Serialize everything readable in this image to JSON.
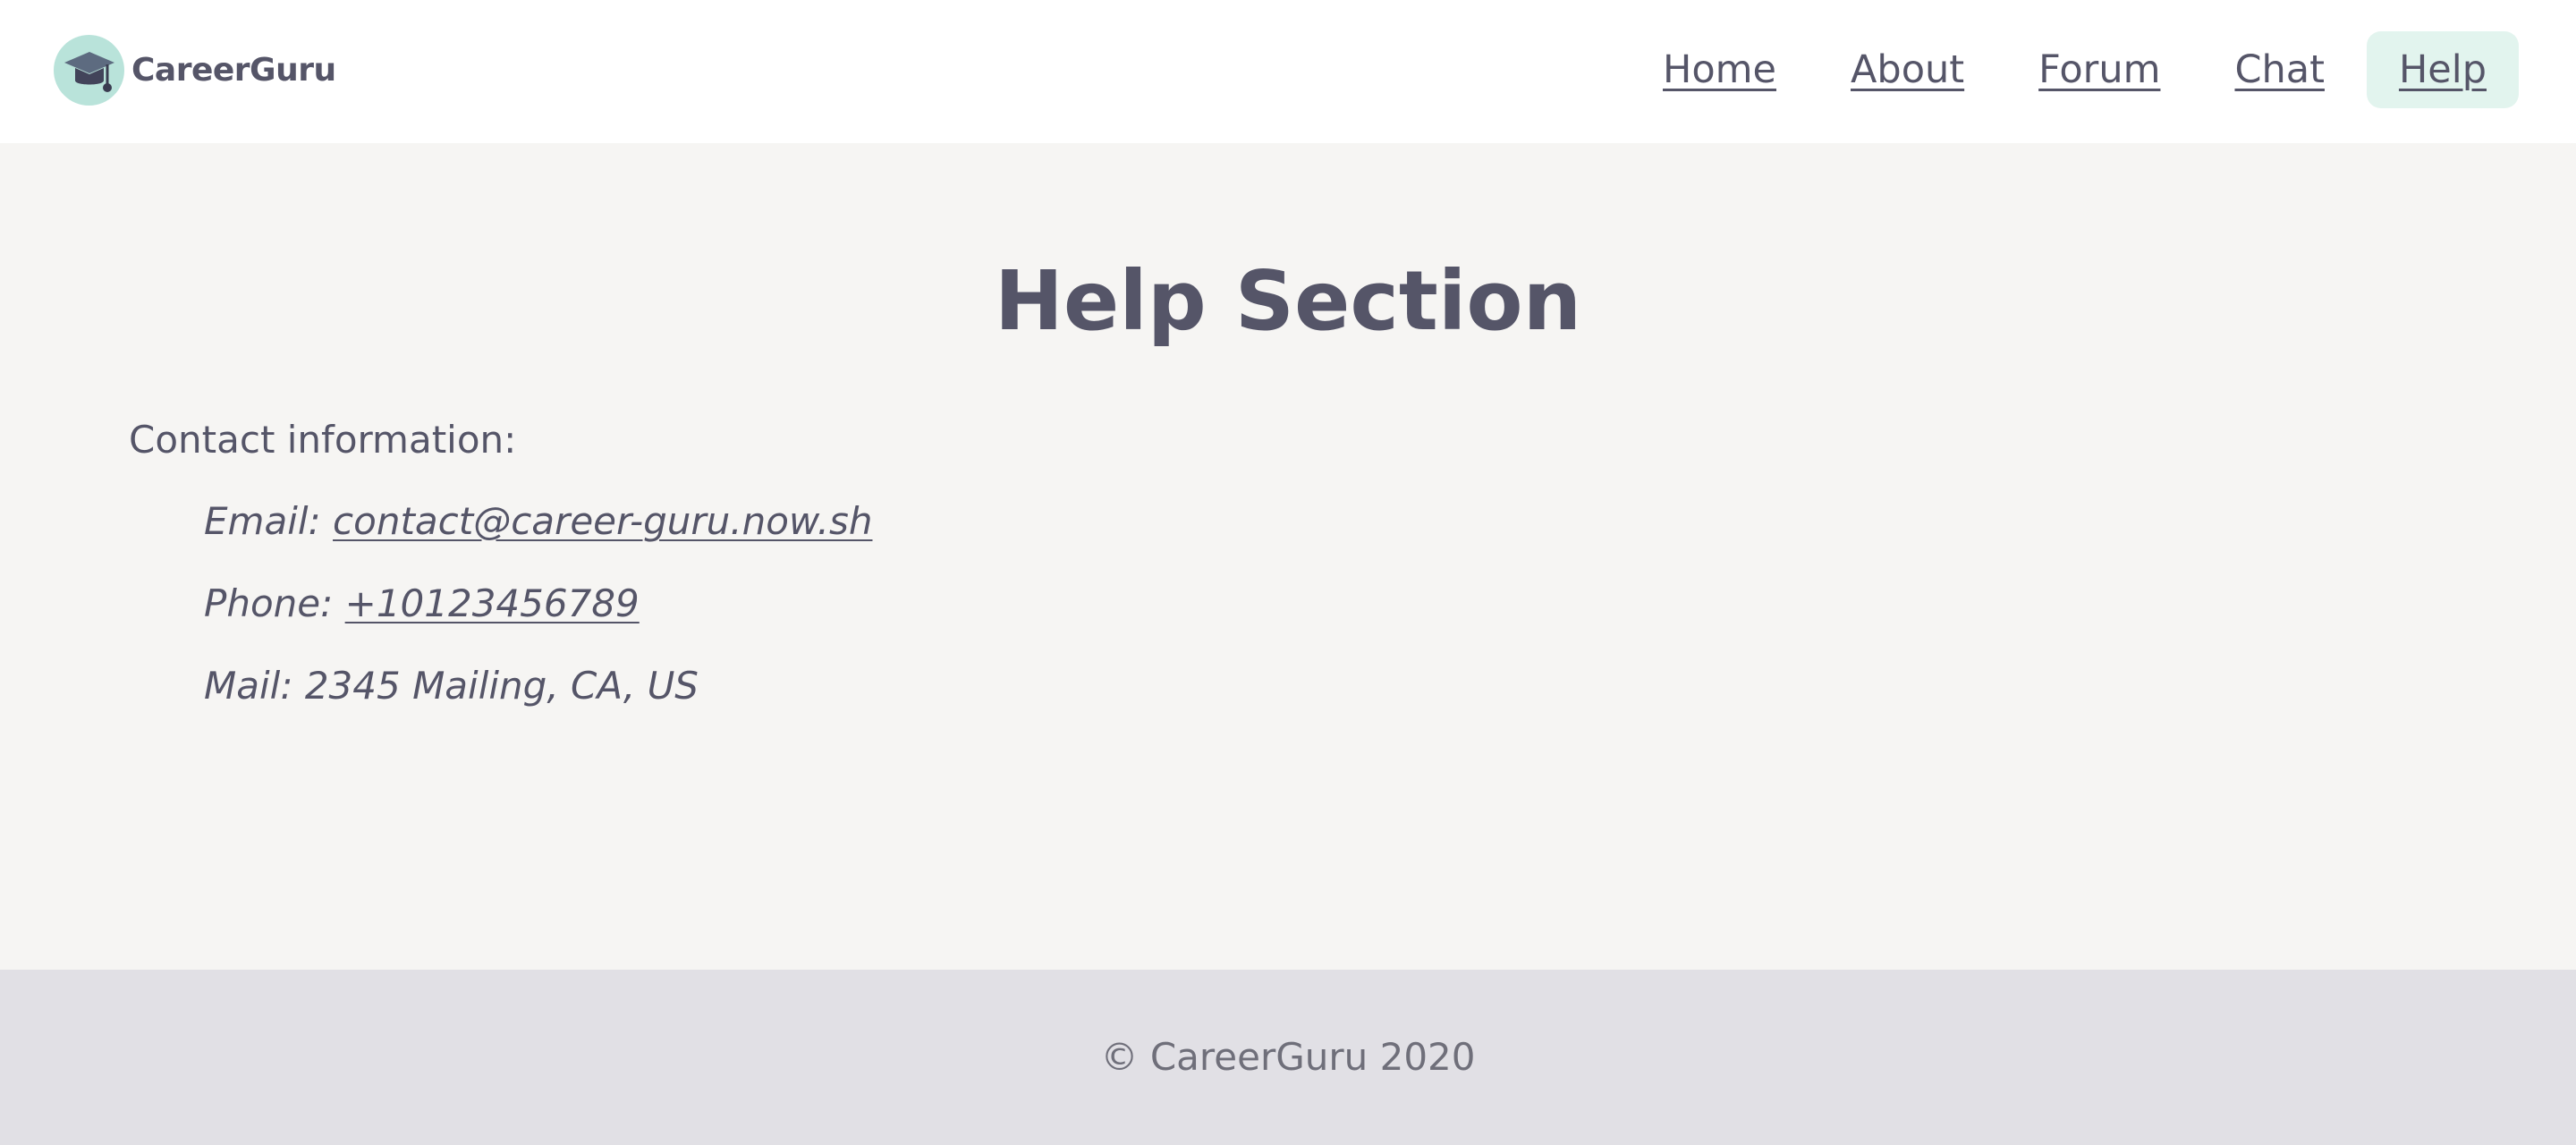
{
  "brand": {
    "name": "CareerGuru",
    "logo_icon": "graduation-cap-icon",
    "logo_bg": "#b9e3da"
  },
  "nav": {
    "items": [
      {
        "label": "Home"
      },
      {
        "label": "About"
      },
      {
        "label": "Forum"
      },
      {
        "label": "Chat"
      },
      {
        "label": "Help",
        "active": true
      }
    ],
    "active_bg": "#e2f4ee"
  },
  "main": {
    "title": "Help Section",
    "contact_heading": "Contact information:",
    "email": {
      "prefix": "Email:",
      "value": "contact@career-guru.now.sh"
    },
    "phone": {
      "prefix": "Phone:",
      "value": "+10123456789"
    },
    "mail": {
      "prefix": "Mail:",
      "value": "2345 Mailing, CA, US"
    }
  },
  "footer": {
    "copyright": "© CareerGuru 2020"
  },
  "colors": {
    "text": "#555568",
    "page_bg": "#f6f5f3",
    "header_bg": "#ffffff",
    "footer_bg": "#e1e0e5"
  }
}
